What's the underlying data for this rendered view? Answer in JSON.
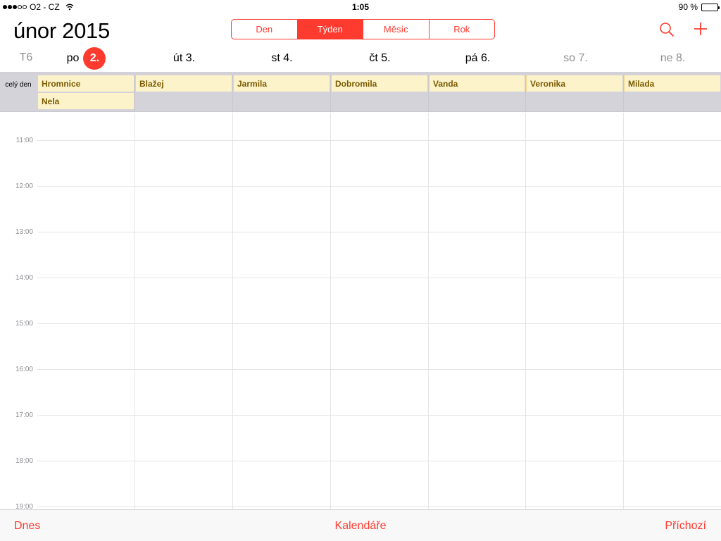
{
  "status_bar": {
    "carrier": "O2 - CZ",
    "time": "1:05",
    "battery": "90 %",
    "battery_level": 0.9
  },
  "header": {
    "month_title": "únor 2015",
    "views": [
      {
        "label": "Den",
        "active": false
      },
      {
        "label": "Týden",
        "active": true
      },
      {
        "label": "Měsíc",
        "active": false
      },
      {
        "label": "Rok",
        "active": false
      }
    ],
    "search_icon": "search-icon",
    "add_icon": "add-icon",
    "accent_color": "#ff3b30"
  },
  "week": {
    "label": "T6",
    "days": [
      {
        "name": "po",
        "number": "2.",
        "today": true
      },
      {
        "name": "út",
        "number": "3.",
        "today": false
      },
      {
        "name": "st",
        "number": "4.",
        "today": false
      },
      {
        "name": "čt",
        "number": "5.",
        "today": false
      },
      {
        "name": "pá",
        "number": "6.",
        "today": false
      },
      {
        "name": "so",
        "number": "7.",
        "today": false,
        "weekend": true
      },
      {
        "name": "ne",
        "number": "8.",
        "today": false,
        "weekend": true
      }
    ]
  },
  "all_day": {
    "label": "celý den",
    "events": [
      {
        "title": "Hromnice",
        "day": 0,
        "row": 0
      },
      {
        "title": "Nela",
        "day": 0,
        "row": 1
      },
      {
        "title": "Blažej",
        "day": 1,
        "row": 0
      },
      {
        "title": "Jarmila",
        "day": 2,
        "row": 0
      },
      {
        "title": "Dobromila",
        "day": 3,
        "row": 0
      },
      {
        "title": "Vanda",
        "day": 4,
        "row": 0
      },
      {
        "title": "Veronika",
        "day": 5,
        "row": 0
      },
      {
        "title": "Milada",
        "day": 6,
        "row": 0
      }
    ]
  },
  "hours": [
    "11:00",
    "12:00",
    "13:00",
    "14:00",
    "15:00",
    "16:00",
    "17:00",
    "18:00",
    "19:00"
  ],
  "toolbar": {
    "today": "Dnes",
    "calendars": "Kalendáře",
    "inbox": "Příchozí"
  }
}
